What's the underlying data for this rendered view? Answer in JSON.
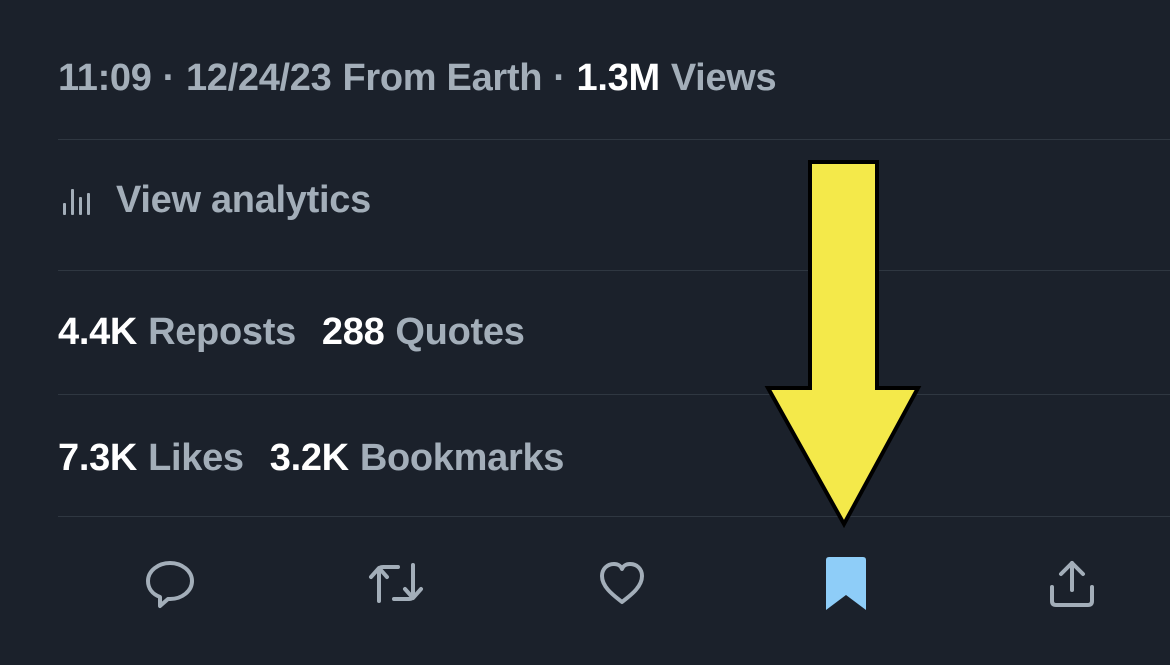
{
  "meta": {
    "time": "11:09",
    "sep1": "·",
    "date": "12/24/23",
    "source": "From Earth",
    "sep2": "·",
    "views_count": "1.3M",
    "views_label": "Views"
  },
  "analytics": {
    "label": "View analytics",
    "icon": "analytics-bars-icon"
  },
  "stats": {
    "reposts_count": "4.4K",
    "reposts_label": "Reposts",
    "quotes_count": "288",
    "quotes_label": "Quotes",
    "likes_count": "7.3K",
    "likes_label": "Likes",
    "bookmarks_count": "3.2K",
    "bookmarks_label": "Bookmarks"
  },
  "actions": [
    {
      "name": "reply",
      "icon": "speech-bubble-icon"
    },
    {
      "name": "repost",
      "icon": "repost-arrows-icon"
    },
    {
      "name": "like",
      "icon": "heart-icon"
    },
    {
      "name": "bookmark",
      "icon": "bookmark-icon",
      "active": true
    },
    {
      "name": "share",
      "icon": "share-upload-icon"
    }
  ],
  "colors": {
    "background": "#1b212b",
    "text_primary": "#ffffff",
    "text_secondary": "#a3aeb9",
    "icon": "#a3aeb9",
    "bookmark_active": "#8ecdf8",
    "annotation_arrow": "#f4e94a"
  },
  "annotation": {
    "type": "yellow-arrow-pointing-down",
    "target": "bookmark-button"
  }
}
